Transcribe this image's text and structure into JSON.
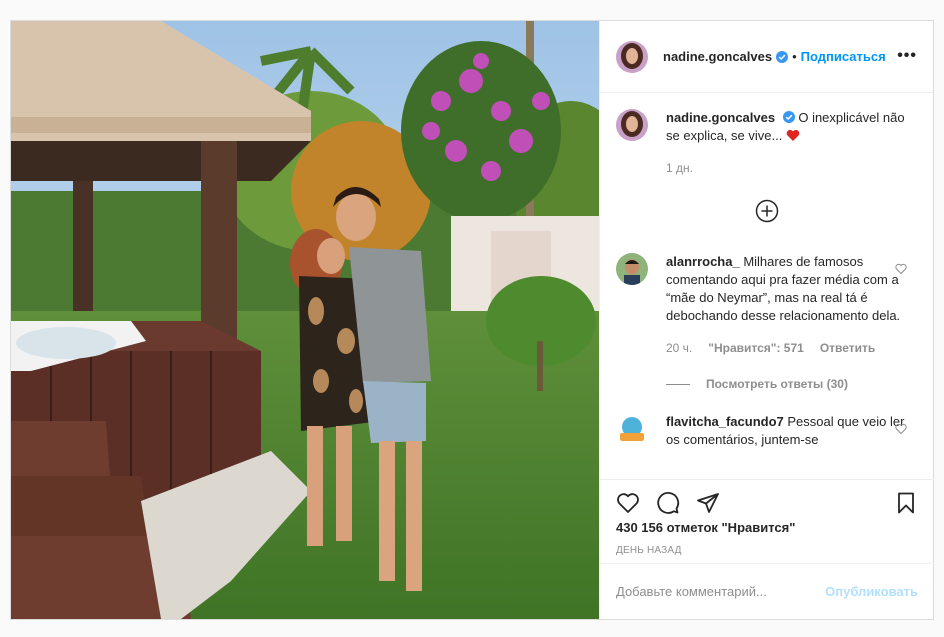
{
  "post": {
    "author": "nadine.goncalves",
    "follow_label": "Подписаться",
    "separator": "•",
    "more_label": "•••",
    "caption_text": "O inexplicável não se explica, se vive...",
    "caption_time": "1 дн.",
    "accent_color": "#0095f6"
  },
  "comments": [
    {
      "user": "alanrrocha_",
      "text": "Milhares de famosos comentando aqui pra fazer média com a “mãe do Neymar”, mas na real tá é debochando desse relacionamento dela.",
      "time": "20 ч.",
      "likes": "\"Нравится\": 571",
      "reply_label": "Ответить",
      "view_replies": "Посмотреть ответы (30)"
    },
    {
      "user": "flavitcha_facundo7",
      "text": "Pessoal que veio ler os comentários, juntem-se"
    }
  ],
  "actions": {
    "likes_count": "430 156 отметок \"Нравится\"",
    "date_label": "ДЕНЬ НАЗАД"
  },
  "add_comment": {
    "placeholder": "Добавьте комментарий...",
    "publish_label": "Опубликовать"
  },
  "icons": {
    "verified": "verified-badge-icon",
    "caption_heart": "red-heart-emoji-icon",
    "load_more": "plus-circle-icon",
    "like": "heart-outline-icon",
    "comment": "comment-bubble-icon",
    "share": "paper-plane-icon",
    "save": "bookmark-icon",
    "comment_like": "small-heart-icon"
  }
}
